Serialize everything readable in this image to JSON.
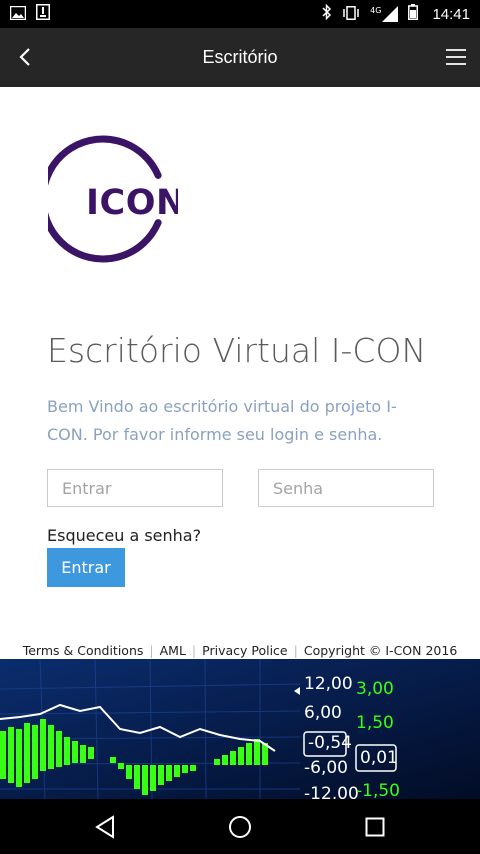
{
  "status_bar": {
    "time": "14:41",
    "network": "4G",
    "icons": [
      "image-icon",
      "sim-icon",
      "bluetooth-icon",
      "vibrate-icon",
      "signal-icon",
      "battery-icon"
    ]
  },
  "app_bar": {
    "title": "Escritório",
    "icons": [
      "back-icon",
      "hamburger-menu-icon"
    ]
  },
  "logo": {
    "text": "ICON",
    "color": "#3b1466"
  },
  "main": {
    "title": "Escritório Virtual I-CON",
    "intro": "Bem Vindo ao escritório virtual do projeto I-CON. Por favor informe seu login e senha.",
    "login_placeholder": "Entrar",
    "password_placeholder": "Senha",
    "forgot_label": "Esqueceu a senha?",
    "submit_label": "Entrar"
  },
  "footer": {
    "terms": "Terms & Conditions",
    "aml": "AML",
    "privacy": "Privacy Police",
    "copyright": "Copyright © I-CON 2016"
  },
  "banner": {
    "left_values": [
      "12,00",
      "6,00",
      "-0,54",
      "-6,00",
      "-12,00"
    ],
    "right_values": [
      "3,00",
      "1,50",
      "0,01",
      "-1,50"
    ],
    "colors": {
      "background": "#04153a",
      "positive": "#39ff14",
      "neutral": "#ffffff"
    }
  },
  "nav_bar": {
    "icons": [
      "nav-back-icon",
      "nav-home-icon",
      "nav-recents-icon"
    ]
  },
  "colors": {
    "accent": "#3d98dd",
    "app_bar": "#262626",
    "intro_text": "#8aa2bf"
  }
}
